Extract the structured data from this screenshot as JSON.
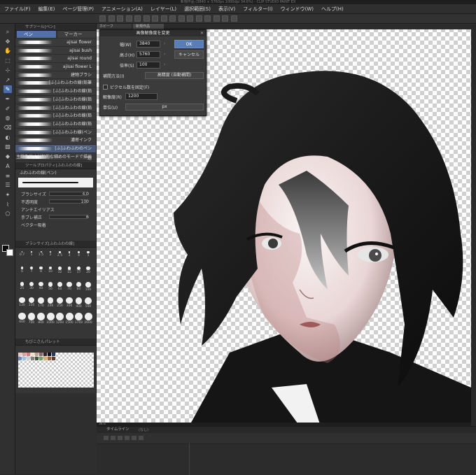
{
  "window": {
    "title": "新規作品 (3840 × 5760px 1000dpi 34.6%) - CLIP STUDIO PAINT EX"
  },
  "menu": [
    "ファイル(F)",
    "編集(E)",
    "ページ管理(P)",
    "アニメーション(A)",
    "レイヤー(L)",
    "選択範囲(S)",
    "表示(V)",
    "フィルター(I)",
    "ウィンドウ(W)",
    "ヘルプ(H)"
  ],
  "canvas_tabs": [
    "カビーフ",
    "新規作品"
  ],
  "subtool": {
    "header": "サブツール[ペン]",
    "tabs": [
      "ペン",
      "マーカー"
    ],
    "brushes": [
      "ajisai flower",
      "ajisai bush",
      "ajisai round",
      "ajisai flower L",
      "建物ブラシ",
      "[ふ]ふわふわの線(鉛筆",
      "[ふ]ふわふわの線(鉛",
      "[ふ]ふわふわの線(鉛",
      "[ふ]ふわふわの線(鉛",
      "[ふ]ふわふわの線(鉛",
      "[ふ]ふわふわの線(鉛",
      "[ふ]ふわふわ線(ペン",
      "濃密インク",
      "[ふ]ふわふわのペン",
      "主線を引く付加的な細めのモードで描画"
    ],
    "footer_label": "魅"
  },
  "tool_property": {
    "header": "ツールプロパティ[ふわふわの線]",
    "brush_name": "ふわふわの線(ペン)",
    "rows": [
      {
        "label": "ブラシサイズ",
        "value": "4.0"
      },
      {
        "label": "不透明度",
        "value": "100"
      },
      {
        "label": "アンチエイリアス",
        "value": ""
      },
      {
        "label": "手ブレ補正",
        "value": "6"
      },
      {
        "label": "ベクター吸着",
        "value": ""
      }
    ]
  },
  "brush_size": {
    "header": "ブラシサイズ[ふわふわの線]",
    "sizes": [
      "0.7",
      "1",
      "1.5",
      "2",
      "2.5",
      "3",
      "4",
      "5",
      "6",
      "7",
      "8",
      "10",
      "12",
      "15",
      "17",
      "20",
      "25",
      "30",
      "40",
      "50",
      "60",
      "70",
      "80",
      "100",
      "120",
      "150",
      "170",
      "200",
      "250",
      "300",
      "400",
      "500",
      "600",
      "700",
      "800",
      "1000",
      "1200",
      "1500",
      "1700",
      "2000"
    ]
  },
  "palette": {
    "header": "ちびこさんパレット"
  },
  "resize_dialog": {
    "title": "画像解像度を変更",
    "width_label": "幅(W)",
    "width_value": "3840",
    "height_label": "高さ(H)",
    "height_value": "5760",
    "scale_label": "倍率(S)",
    "scale_value": "100",
    "interp_label": "補間方法(I)",
    "interp_value": "高精度 (自動補間)",
    "fix_pixels_label": "ピクセル数を固定(F)",
    "resolution_label": "解像度(R)",
    "resolution_value": "1200",
    "unit_label": "単位(U)",
    "unit_value": "px",
    "ok_label": "OK",
    "cancel_label": "キャンセル"
  },
  "status": {
    "zoom": "34.6"
  },
  "timeline": {
    "header": "タイムライン",
    "track": "(なし)"
  },
  "colors": {
    "accent": "#5471a5",
    "primary": "#0b0b0b",
    "secondary": "#ffffff"
  }
}
